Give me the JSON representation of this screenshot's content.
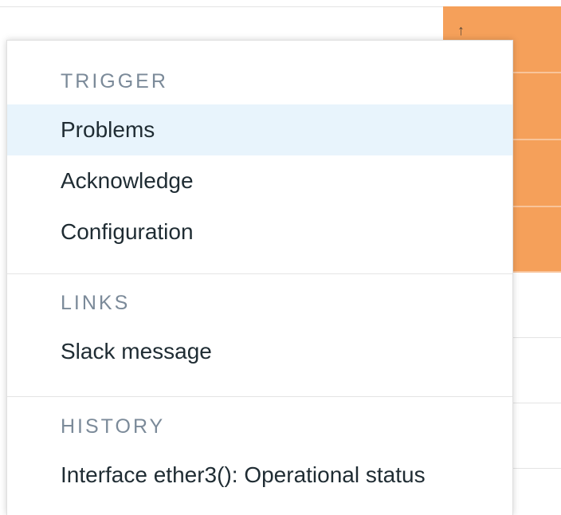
{
  "menu": {
    "sections": [
      {
        "title": "TRIGGER",
        "items": [
          {
            "label": "Problems",
            "highlighted": true
          },
          {
            "label": "Acknowledge"
          },
          {
            "label": "Configuration"
          }
        ]
      },
      {
        "title": "LINKS",
        "items": [
          {
            "label": "Slack message"
          }
        ]
      },
      {
        "title": "HISTORY",
        "items": [
          {
            "label": "Interface ether3(): Operational status"
          }
        ]
      }
    ]
  },
  "background": {
    "sort_icon": "sort-up-icon",
    "severity_color": "#f5a05a",
    "highlight_color": "#e8f4fc"
  }
}
